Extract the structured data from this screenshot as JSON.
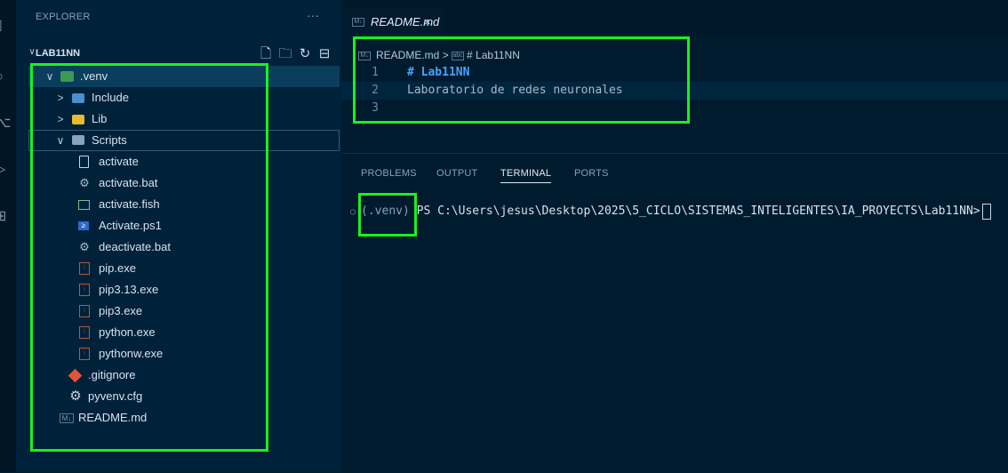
{
  "sidebar": {
    "header": "EXPLORER",
    "more": "···",
    "project": {
      "chevron": "∨",
      "title": "LAB11NN"
    },
    "project_actions": [
      "new-file-icon",
      "new-folder-icon",
      "refresh-icon",
      "collapse-all-icon"
    ],
    "tree": [
      {
        "label": ".venv",
        "chevron": "∨",
        "icon": "venv-folder-icon"
      },
      {
        "label": "Include",
        "chevron": ">",
        "icon": "folder-icon"
      },
      {
        "label": "Lib",
        "chevron": ">",
        "icon": "lib-folder-icon"
      },
      {
        "label": "Scripts",
        "chevron": "∨",
        "icon": "scripts-folder-icon"
      },
      {
        "label": "activate",
        "icon": "file-icon"
      },
      {
        "label": "activate.bat",
        "icon": "gear-icon"
      },
      {
        "label": "activate.fish",
        "icon": "terminal-icon"
      },
      {
        "label": "Activate.ps1",
        "icon": "powershell-icon"
      },
      {
        "label": "deactivate.bat",
        "icon": "gear-icon"
      },
      {
        "label": "pip.exe",
        "icon": "exe-icon"
      },
      {
        "label": "pip3.13.exe",
        "icon": "exe-icon"
      },
      {
        "label": "pip3.exe",
        "icon": "exe-icon"
      },
      {
        "label": "python.exe",
        "icon": "exe-icon"
      },
      {
        "label": "pythonw.exe",
        "icon": "exe-icon"
      },
      {
        "label": ".gitignore",
        "icon": "git-icon"
      },
      {
        "label": "pyvenv.cfg",
        "icon": "settings-icon"
      },
      {
        "label": "README.md",
        "icon": "markdown-icon"
      }
    ]
  },
  "editor": {
    "tab": {
      "label": "README.md",
      "close": "×"
    },
    "breadcrumb": {
      "file": "README.md",
      "sep": ">",
      "symbol": "# Lab11NN"
    },
    "lines": [
      {
        "num": "1",
        "text": "# Lab11NN"
      },
      {
        "num": "2",
        "text": "Laboratorio de redes neuronales"
      },
      {
        "num": "3",
        "text": ""
      }
    ]
  },
  "panel": {
    "tabs": [
      "PROBLEMS",
      "OUTPUT",
      "TERMINAL",
      "PORTS"
    ],
    "active_tab": "TERMINAL",
    "terminal": {
      "dot": "○",
      "venv": "(.venv)",
      "prompt": "PS C:\\Users\\jesus\\Desktop\\2025\\5_CICLO\\SISTEMAS_INTELIGENTES\\IA_PROYECTS\\Lab11NN>"
    }
  },
  "colors": {
    "highlight_box": "#18f21e",
    "heading": "#46a3ff",
    "selected_row": "#0a3e5c"
  }
}
